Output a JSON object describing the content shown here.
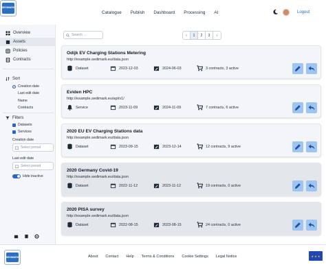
{
  "header": {
    "logo_text": "SEDIMARK",
    "nav": [
      "Catalogue",
      "Publish",
      "Dashboard",
      "Processing",
      "AI"
    ],
    "logout": "Logout"
  },
  "sidebar": {
    "items": [
      {
        "label": "Overview",
        "icon": "overview-icon",
        "active": false
      },
      {
        "label": "Assets",
        "icon": "assets-icon",
        "active": true
      },
      {
        "label": "Policies",
        "icon": "policies-icon",
        "active": false
      },
      {
        "label": "Contracts",
        "icon": "contracts-icon",
        "active": false
      }
    ],
    "sort": {
      "title": "Sort",
      "options": [
        {
          "label": "Creation date",
          "selected": true
        },
        {
          "label": "Last edit date",
          "selected": false
        },
        {
          "label": "Name",
          "selected": false
        },
        {
          "label": "Contracts",
          "selected": false
        }
      ]
    },
    "filters": {
      "title": "Filters",
      "checks": [
        {
          "label": "Datasets",
          "checked": true
        },
        {
          "label": "Services",
          "checked": true
        }
      ],
      "creation_label": "Creation date",
      "creation_placeholder": "Select period",
      "edit_label": "Last edit date",
      "edit_placeholder": "Select period",
      "hide_inactive": "Hide inactive"
    }
  },
  "main": {
    "search_placeholder": "Search ...",
    "pager": {
      "prev": "‹",
      "pages": [
        "1",
        "2",
        "3"
      ],
      "next": "›",
      "current": "1"
    }
  },
  "assets": [
    {
      "title": "Odijk EV Charging Stations Metering",
      "url": "http://example.sedimark.eu/data.json",
      "type": "Dataset",
      "created": "2023-12-03",
      "edited": "2024-06-03",
      "contracts": "3 contracts, 3 active",
      "style": "light"
    },
    {
      "title": "Eviden HPC",
      "url": "http://example.sedimark.eu/api/v1/",
      "type": "Service",
      "created": "2023-11-09",
      "edited": "2024-11-09",
      "contracts": "7 contracts, 6 active",
      "style": "light"
    },
    {
      "title": "2020 EU EV Charging Stations data",
      "url": "http://example.sedimark.eu/data.json",
      "type": "Dataset",
      "created": "2023-09-15",
      "edited": "2023-12-14",
      "contracts": "12 contracts, 9 active",
      "style": "light"
    },
    {
      "title": "2020 Germany Covid-19",
      "url": "http://example.sedimark.eu/data.json",
      "type": "Dataset",
      "created": "2022-11-12",
      "edited": "2023-11-12",
      "contracts": "19 contracts, 0 active",
      "style": "gray"
    },
    {
      "title": "2020 PISA survey",
      "url": "http://example.sedimark.eu/data.json",
      "type": "Dataset",
      "created": "2022-08-15",
      "edited": "2023-08-15",
      "contracts": "24 contracts, 0 active",
      "style": "gray"
    }
  ],
  "footer": {
    "links": [
      "About",
      "Contact",
      "Help",
      "Terms & Conditions",
      "Cookie Settings",
      "Legal Notice"
    ],
    "flag_stars": "★ ★ ★"
  },
  "colors": {
    "accent": "#2b64c8",
    "action_button": "#9ec4f2",
    "card_active": "#f3f5f8",
    "card_inactive": "#e3e6ea"
  }
}
